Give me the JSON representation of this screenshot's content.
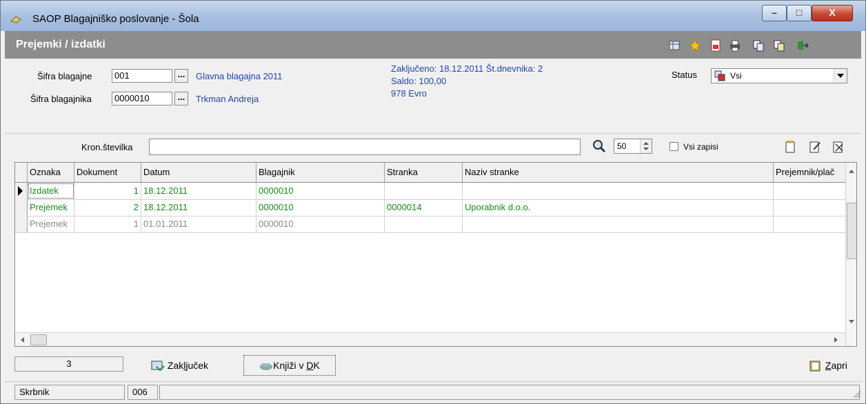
{
  "window": {
    "title": "SAOP Blagajniško poslovanje - Šola",
    "min": "–",
    "max": "□",
    "close": "X"
  },
  "caption": {
    "title": "Prejemki / izdatki"
  },
  "header": {
    "sifra_blagajne_label": "Šifra blagajne",
    "sifra_blagajne_value": "001",
    "blagajna_name": "Glavna blagajna 2011",
    "sifra_blagajnika_label": "Šifra blagajnika",
    "sifra_blagajnika_value": "0000010",
    "blagajnik_name": "Trkman Andreja",
    "zakljuceno": "Zaključeno: 18.12.2011 Št.dnevnika: 2",
    "saldo": "Saldo:  100,00",
    "valuta": "978 Evro",
    "status_label": "Status",
    "status_value": "Vsi",
    "dots": "..."
  },
  "filter": {
    "kron_label": "Kron.številka",
    "kron_value": "",
    "limit_value": "50",
    "vsi_zapisi_label": "Vsi zapisi"
  },
  "grid": {
    "columns": [
      "Oznaka",
      "Dokument",
      "Datum",
      "Blagajnik",
      "Stranka",
      "Naziv stranke",
      "Prejemnik/plač"
    ],
    "rows": [
      {
        "oznaka": "Izdatek",
        "dokument": "1",
        "datum": "18.12.2011",
        "blagajnik": "0000010",
        "stranka": "",
        "naziv": "",
        "style": "green"
      },
      {
        "oznaka": "Prejemek",
        "dokument": "2",
        "datum": "18.12.2011",
        "blagajnik": "0000010",
        "stranka": "0000014",
        "naziv": "Uporabnik d.o.o.",
        "style": "green"
      },
      {
        "oznaka": "Prejemek",
        "dokument": "1",
        "datum": "01.01.2011",
        "blagajnik": "0000010",
        "stranka": "",
        "naziv": "",
        "style": "gray"
      }
    ]
  },
  "footer": {
    "count": "3",
    "zakljucek_pre": "Zak",
    "zakljucek_u": "l",
    "zakljucek_post": "juček",
    "knjizi_pre": "Knjiži v ",
    "knjizi_u": "D",
    "knjizi_post": "K",
    "zapri_u": "Z",
    "zapri_post": "apri"
  },
  "statusbar": {
    "user": "Skrbnik",
    "code": "006"
  }
}
